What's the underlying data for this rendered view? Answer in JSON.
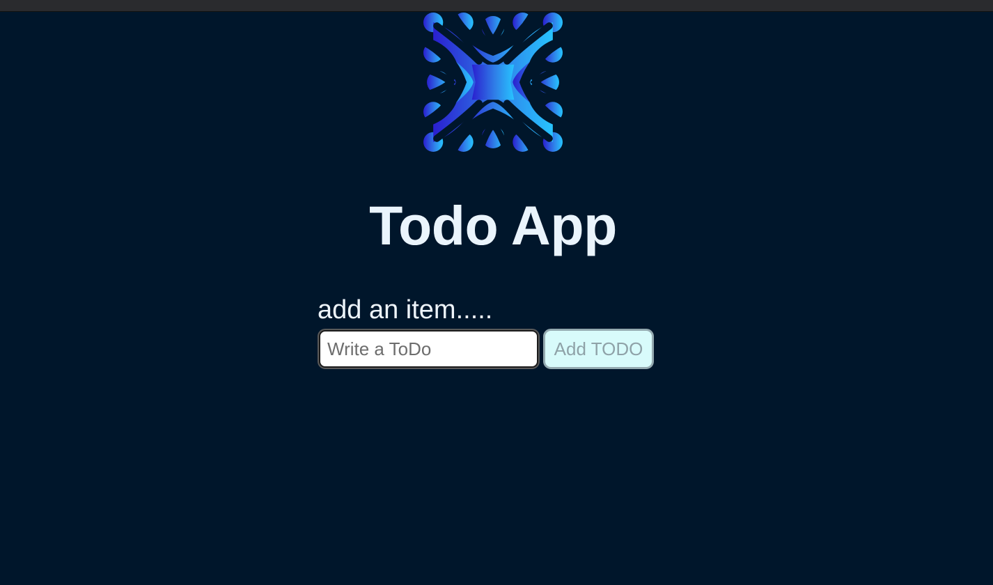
{
  "window": {
    "title_bar": ""
  },
  "logo": {
    "icon": "x-molecule-logo",
    "gradient_start": "#2a1fcf",
    "gradient_end": "#27c4ff"
  },
  "header": {
    "title": "Todo App"
  },
  "form": {
    "prompt_label": "add an item.....",
    "input_value": "",
    "input_placeholder": "Write a ToDo",
    "add_button_label": "Add TODO"
  },
  "colors": {
    "background": "#00162b",
    "title_text": "#eaf4fc",
    "button_bg": "#d8fbfb",
    "button_text": "#8fa2a8"
  }
}
